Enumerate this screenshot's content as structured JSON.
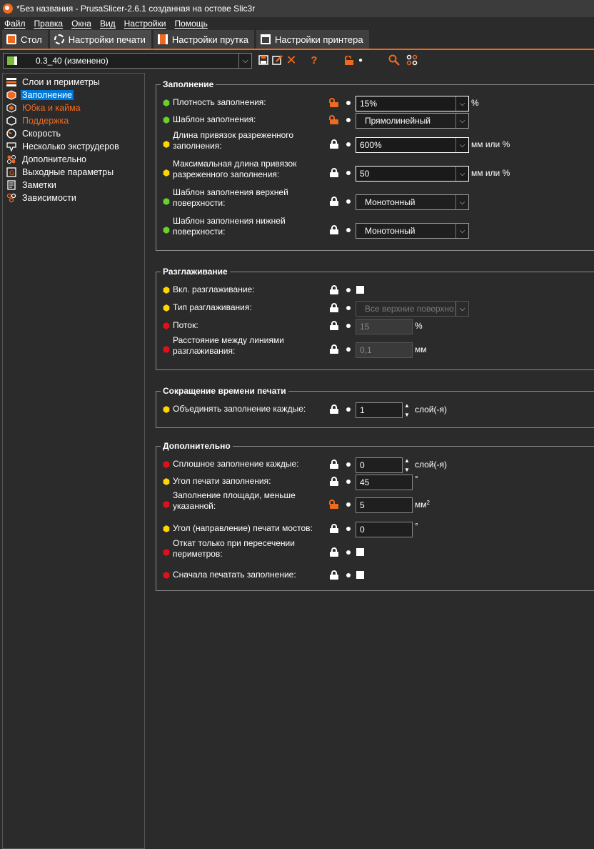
{
  "window": {
    "title": "*Без названия - PrusaSlicer-2.6.1 созданная на остове Slic3r"
  },
  "menu": [
    "Файл",
    "Правка",
    "Окна",
    "Вид",
    "Настройки",
    "Помощь"
  ],
  "tabs": [
    {
      "label": "Стол",
      "icon": "plater-icon"
    },
    {
      "label": "Настройки печати",
      "icon": "print-settings-icon"
    },
    {
      "label": "Настройки прутка",
      "icon": "filament-icon"
    },
    {
      "label": "Настройки принтера",
      "icon": "printer-icon"
    }
  ],
  "preset": {
    "value": "0.3_40 (изменено)"
  },
  "toolbar_icons": [
    "save-icon",
    "edit-icon",
    "delete-icon",
    "question-icon",
    "unlock-icon",
    "dot-icon",
    "search-icon",
    "compare-icon"
  ],
  "toolbar_glyphs": {
    "help": "?"
  },
  "sidebar": {
    "items": [
      {
        "label": "Слои и периметры",
        "icon": "layers-icon"
      },
      {
        "label": "Заполнение",
        "icon": "infill-icon"
      },
      {
        "label": "Юбка и кайма",
        "icon": "skirt-icon"
      },
      {
        "label": "Поддержка",
        "icon": "support-icon"
      },
      {
        "label": "Скорость",
        "icon": "speed-icon"
      },
      {
        "label": "Несколько экструдеров",
        "icon": "extruders-icon"
      },
      {
        "label": "Дополнительно",
        "icon": "advanced-icon"
      },
      {
        "label": "Выходные параметры",
        "icon": "output-icon"
      },
      {
        "label": "Заметки",
        "icon": "notes-icon"
      },
      {
        "label": "Зависимости",
        "icon": "dependencies-icon"
      }
    ]
  },
  "groups": {
    "infill": {
      "title": "Заполнение",
      "rows": [
        {
          "label": "Плотность заполнения:",
          "value": "15%",
          "unit": "%"
        },
        {
          "label": "Шаблон заполнения:",
          "value": "Прямолинейный"
        },
        {
          "label": "Длина привязок разреженного заполнения:",
          "value": "600%",
          "unit": "мм или %"
        },
        {
          "label": "Максимальная длина привязок разреженного заполнения:",
          "value": "50",
          "unit": "мм или %"
        },
        {
          "label": "Шаблон заполнения верхней поверхности:",
          "value": "Монотонный"
        },
        {
          "label": "Шаблон заполнения нижней поверхности:",
          "value": "Монотонный"
        }
      ]
    },
    "ironing": {
      "title": "Разглаживание",
      "rows": [
        {
          "label": "Вкл. разглаживание:"
        },
        {
          "label": "Тип разглаживания:",
          "value": "Все верхние поверхнос"
        },
        {
          "label": "Поток:",
          "value": "15",
          "unit": "%"
        },
        {
          "label": "Расстояние между линиями разглаживания:",
          "value": "0,1",
          "unit": "мм"
        }
      ]
    },
    "reducing": {
      "title": "Сокращение времени печати",
      "rows": [
        {
          "label": "Объединять заполнение каждые:",
          "value": "1",
          "unit": "слой(-я)"
        }
      ]
    },
    "advanced": {
      "title": "Дополнительно",
      "rows": [
        {
          "label": "Сплошное заполнение каждые:",
          "value": "0",
          "unit": "слой(-я)"
        },
        {
          "label": "Угол печати заполнения:",
          "value": "45",
          "unit": "°"
        },
        {
          "label": "Заполнение площади, меньше указанной:",
          "value": "5",
          "unit": "мм",
          "unit_sup": "2"
        },
        {
          "label": "Угол (направление) печати мостов:",
          "value": "0",
          "unit": "°"
        },
        {
          "label": "Откат только при пересечении периметров:"
        },
        {
          "label": "Сначала печатать заполнение:"
        }
      ]
    }
  },
  "colors": {
    "accent": "#ed6b21",
    "simple": "#6ad12c",
    "advanced": "#ffd700",
    "expert": "#e3101c",
    "selection": "#0078d7"
  }
}
